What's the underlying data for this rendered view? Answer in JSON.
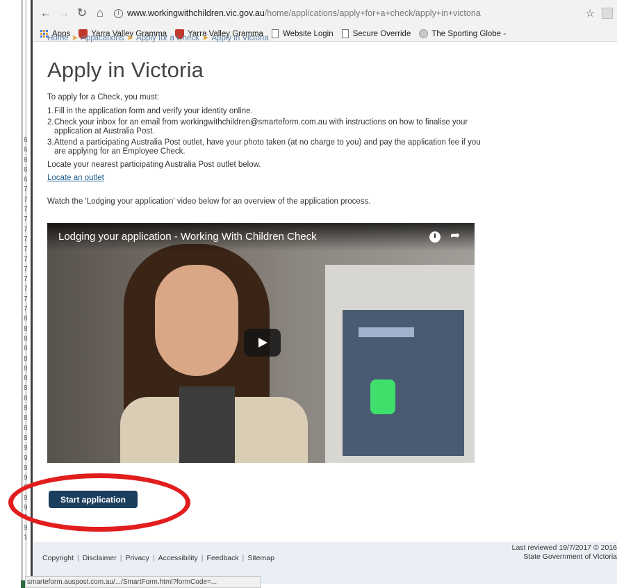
{
  "browser": {
    "url_host": "www.workingwithchildren.vic.gov.au",
    "url_path": "/home/applications/apply+for+a+check/apply+in+victoria",
    "bookmarks": [
      {
        "icon": "apps-icon",
        "label": "Apps"
      },
      {
        "icon": "school-crest-icon",
        "label": "Yarra Valley Gramma"
      },
      {
        "icon": "school-crest-icon",
        "label": "Yarra Valley Gramma"
      },
      {
        "icon": "page-icon",
        "label": "Website Login"
      },
      {
        "icon": "page-icon",
        "label": "Secure Override"
      },
      {
        "icon": "globe-icon",
        "label": "The Sporting Globe -"
      }
    ],
    "status_url": "smarteform.auspost.com.au/.../SmartForm.html?formCode=..."
  },
  "gutter_numbers": [
    "6",
    "6",
    "6",
    "6",
    "6",
    "7",
    "7",
    "7",
    "7",
    "7",
    "7",
    "7",
    "7",
    "7",
    "7",
    "7",
    "7",
    "7",
    "8",
    "8",
    "8",
    "8",
    "8",
    "8",
    "8",
    "8",
    "8",
    "8",
    "8",
    "8",
    "8",
    "9",
    "9",
    "9",
    "9",
    "9",
    "9",
    "9",
    "9",
    "9",
    "1"
  ],
  "breadcrumb": [
    "Home",
    "Applications",
    "Apply for a Check",
    "Apply in Victoria"
  ],
  "page": {
    "title": "Apply in Victoria",
    "intro": "To apply for a Check, you must:",
    "steps": [
      {
        "num": "1.",
        "text": "Fill in the application form and verify your identity online."
      },
      {
        "num": "2.",
        "text": "Check your inbox for an email from workingwithchildren@smarteform.com.au with instructions on how to finalise your application at Australia Post."
      },
      {
        "num": "3.",
        "text": "Attend a participating Australia Post outlet, have your photo taken (at no charge to you) and pay the application fee if you are applying for an Employee Check."
      }
    ],
    "locate_text": "Locate your nearest participating Australia Post outlet below.",
    "locate_link": "Locate an outlet",
    "watch_text": "Watch the 'Lodging your application' video below for an overview of the application process.",
    "video_title": "Lodging your application - Working With Children Check",
    "start_button": "Start application"
  },
  "footer": {
    "links": [
      "Copyright",
      "Disclaimer",
      "Privacy",
      "Accessibility",
      "Feedback",
      "Sitemap"
    ],
    "reviewed": "Last reviewed 19/7/2017 © 2016",
    "government": "State Government of Victoria"
  },
  "annotation_color": "#e21d1d"
}
